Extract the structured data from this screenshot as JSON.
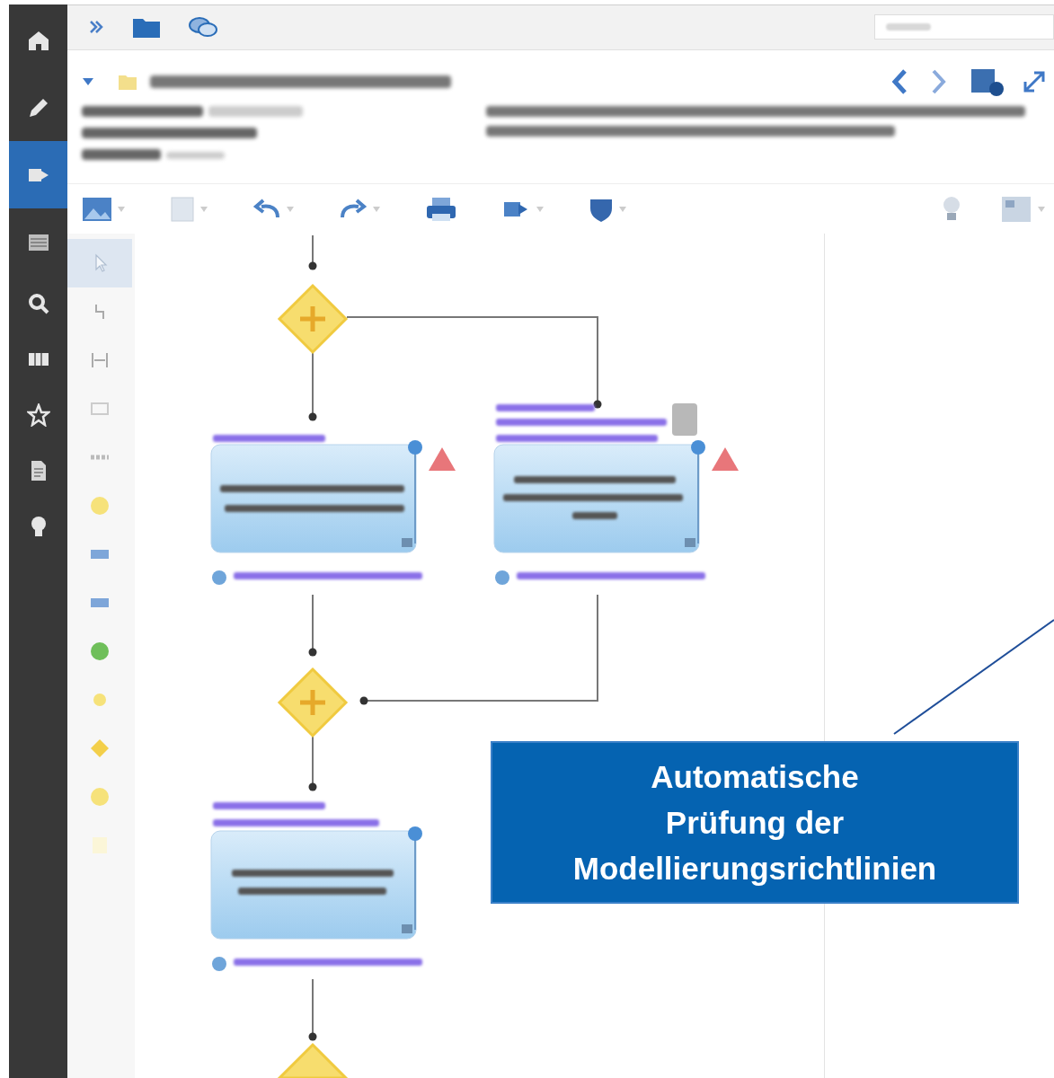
{
  "sidebar": {
    "items": [
      {
        "selected": false
      },
      {
        "selected": false
      },
      {
        "selected": true
      },
      {
        "selected": false
      },
      {
        "selected": false
      },
      {
        "selected": false
      },
      {
        "selected": false
      },
      {
        "selected": false
      },
      {
        "selected": false
      }
    ]
  },
  "palette": [
    {
      "kind": "pointer",
      "selected": true
    },
    {
      "kind": "connect",
      "selected": false
    },
    {
      "kind": "space",
      "selected": false
    },
    {
      "kind": "frame",
      "selected": false
    },
    {
      "kind": "dashes",
      "selected": false
    },
    {
      "kind": "circle",
      "selected": false
    },
    {
      "kind": "label",
      "selected": false
    },
    {
      "kind": "label",
      "selected": false
    },
    {
      "kind": "green",
      "selected": false
    },
    {
      "kind": "dot",
      "selected": false
    },
    {
      "kind": "diamond",
      "selected": false
    },
    {
      "kind": "circle",
      "selected": false
    },
    {
      "kind": "note",
      "selected": false
    }
  ],
  "diagram": {
    "tasks": [
      {
        "warning": true,
        "attachment": false
      },
      {
        "warning": true,
        "attachment": true
      },
      {
        "warning": false,
        "attachment": false
      }
    ]
  },
  "callout": {
    "text": "Automatische\nPrüfung der\nModellierungsrichtlinien"
  }
}
